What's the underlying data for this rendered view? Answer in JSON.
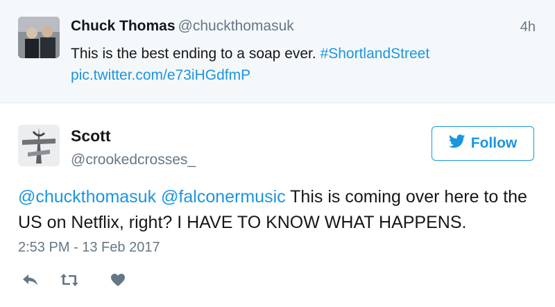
{
  "parent_tweet": {
    "author_name": "Chuck Thomas",
    "author_handle": "@chuckthomasuk",
    "time": "4h",
    "text_plain": "This is the best ending to a soap ever.",
    "hashtag": "#ShortlandStreet",
    "link": "pic.twitter.com/e73iHGdfmP"
  },
  "tweet": {
    "author_name": "Scott",
    "author_handle": "@crookedcrosses_",
    "follow_label": "Follow",
    "mention1": "@chuckthomasuk",
    "mention2": "@falconermusic",
    "text_rest": "This is coming over here to the US on Netflix, right? I HAVE TO KNOW WHAT HAPPENS.",
    "timestamp": "2:53 PM - 13 Feb 2017"
  },
  "actions": [
    {
      "icon": "reply-icon"
    },
    {
      "icon": "retweet-icon"
    },
    {
      "icon": "like-icon"
    }
  ],
  "colors": {
    "link": "#1b95e0",
    "secondary_text": "#657786",
    "parent_background": "#f5f8fa",
    "action_icon": "#657786"
  }
}
